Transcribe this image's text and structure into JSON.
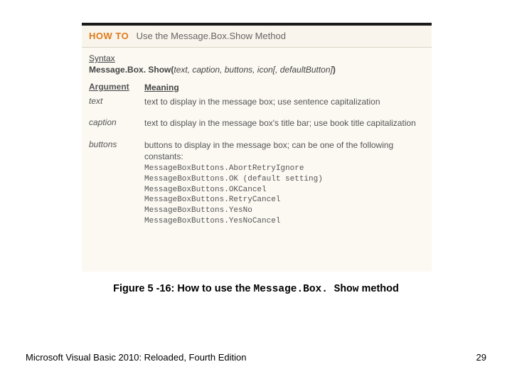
{
  "howto": {
    "label": "HOW TO",
    "title": "Use the Message.Box.Show Method",
    "syntax_label": "Syntax",
    "syntax_bold1": "Message.Box. Show(",
    "syntax_args": "text, caption, buttons, icon",
    "syntax_opt": "[, defaultButton]",
    "syntax_bold2": ")",
    "args_header_name": "Argument",
    "args_header_meaning": "Meaning",
    "args": [
      {
        "name": "text",
        "meaning": "text to display in the message box; use sentence capitalization"
      },
      {
        "name": "caption",
        "meaning": "text to display in the message box's title bar; use book title capitalization"
      },
      {
        "name": "buttons",
        "meaning_intro": "buttons to display in the message box; can be one of the following constants:",
        "constants": [
          "MessageBoxButtons.AbortRetryIgnore",
          "MessageBoxButtons.OK (default setting)",
          "MessageBoxButtons.OKCancel",
          "MessageBoxButtons.RetryCancel",
          "MessageBoxButtons.YesNo",
          "MessageBoxButtons.YesNoCancel"
        ]
      }
    ]
  },
  "caption": {
    "prefix": "Figure 5 -16: How to use the ",
    "mono": "Message.Box. Show",
    "suffix": " method"
  },
  "footer": {
    "left": "Microsoft Visual Basic 2010: Reloaded, Fourth Edition",
    "page": "29"
  }
}
